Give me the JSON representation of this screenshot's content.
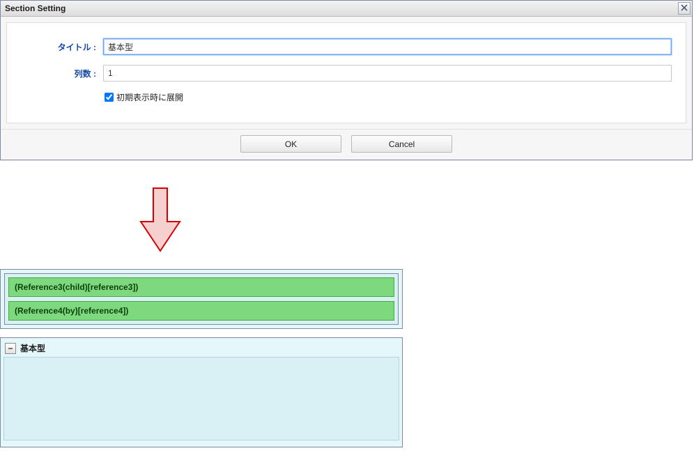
{
  "dialog": {
    "title": "Section Setting",
    "fields": {
      "title_label": "タイトル",
      "title_value": "基本型",
      "cols_label": "列数",
      "cols_value": "1"
    },
    "checkbox": {
      "label": "初期表示時に展開",
      "checked": true
    },
    "buttons": {
      "ok": "OK",
      "cancel": "Cancel"
    }
  },
  "arrow": {
    "color_fill": "#f6cfcf",
    "color_stroke": "#d20000"
  },
  "refs": [
    "(Reference3(child)[reference3])",
    "(Reference4(by)[reference4])"
  ],
  "section": {
    "title": "基本型",
    "collapse_glyph": "−"
  }
}
